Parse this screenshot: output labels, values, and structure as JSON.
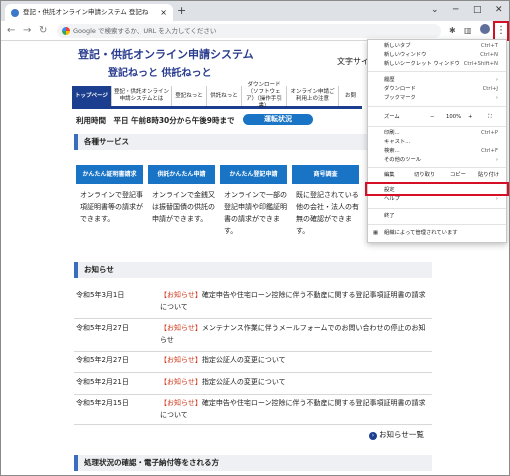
{
  "browser": {
    "tab_title": "登記・供託オンライン申請システム 登記ね",
    "tab_close": "×",
    "new_tab": "+",
    "window_controls": {
      "chevron": "⌄",
      "minimize": "─",
      "maximize": "□",
      "close": "✕"
    },
    "address_placeholder": "Google で検索するか、URL を入力してください",
    "kebab": "⋮"
  },
  "site": {
    "title": "登記・供託オンライン申請システム",
    "subtitle": "登記ねっと 供託ねっと",
    "font_size_label": "文字サイ"
  },
  "nav": [
    {
      "label": "トップページ",
      "active": true
    },
    {
      "label": "登記・供託オンライン申請システムとは"
    },
    {
      "label": "登記ねっと"
    },
    {
      "label": "供託ねっと"
    },
    {
      "label": "ダウンロード（ソフトウェア）（操作手引書）"
    },
    {
      "label": "オンライン申請ご利用上の注意"
    },
    {
      "label": "お問"
    }
  ],
  "hours": {
    "text": "利用時間　平日 午前8時30分から午後9時まで",
    "status_button": "運転状況"
  },
  "services": {
    "heading": "各種サービス",
    "items": [
      {
        "label": "かんたん証明書請求",
        "desc": "オンラインで登記事項証明書等の請求ができます。"
      },
      {
        "label": "供託かんたん申請",
        "desc": "オンラインで金銭又は振替国債の供託の申請ができます。"
      },
      {
        "label": "かんたん登記申請",
        "desc": "オンラインで一部の登記申請や印鑑証明書の請求ができます。"
      },
      {
        "label": "商号調査",
        "desc": "既に登記されている他の会社・法人の有無の確認ができます。"
      }
    ]
  },
  "news": {
    "heading": "お知らせ",
    "items": [
      {
        "date": "令和5年3月1日",
        "badge": "【お知らせ】",
        "text": "確定申告や住宅ローン控除に伴う不動産に関する登記事項証明書の請求について"
      },
      {
        "date": "令和5年2月27日",
        "badge": "【お知らせ】",
        "text": "メンテナンス作業に伴うメールフォームでのお問い合わせの停止のお知らせ"
      },
      {
        "date": "令和5年2月27日",
        "badge": "【お知らせ】",
        "text": "指定公証人の変更について"
      },
      {
        "date": "令和5年2月21日",
        "badge": "【お知らせ】",
        "text": "指定公証人の変更について"
      },
      {
        "date": "令和5年2月15日",
        "badge": "【お知らせ】",
        "text": "確定申告や住宅ローン控除に伴う不動産に関する登記事項証明書の請求について"
      }
    ],
    "more": "お知らせ一覧",
    "more_icon": "›"
  },
  "procedure_heading": "処理状況の確認・電子納付等をされる方",
  "menu": {
    "items_top": [
      {
        "label": "新しいタブ",
        "shortcut": "Ctrl+T"
      },
      {
        "label": "新しいウィンドウ",
        "shortcut": "Ctrl+N"
      },
      {
        "label": "新しいシークレット ウィンドウ",
        "shortcut": "Ctrl+Shift+N"
      }
    ],
    "items_mid": [
      {
        "label": "履歴",
        "shortcut": "›"
      },
      {
        "label": "ダウンロード",
        "shortcut": "Ctrl+J"
      },
      {
        "label": "ブックマーク",
        "shortcut": "›"
      }
    ],
    "zoom": {
      "label": "ズーム",
      "minus": "−",
      "value": "100%",
      "plus": "+",
      "full": "⛶"
    },
    "items_print": [
      {
        "label": "印刷...",
        "shortcut": "Ctrl+P"
      },
      {
        "label": "キャスト..."
      },
      {
        "label": "検索...",
        "shortcut": "Ctrl+F"
      },
      {
        "label": "その他のツール",
        "shortcut": "›"
      }
    ],
    "edit": {
      "label": "編集",
      "cut": "切り取り",
      "copy": "コピー",
      "paste": "貼り付け"
    },
    "settings": "設定",
    "help": "ヘルプ",
    "help_arrow": "›",
    "exit": "終了",
    "managed": "組織によって管理されています"
  },
  "colors": {
    "accent": "#1c3e8f",
    "button_blue": "#1a74c6",
    "highlight_red": "#d50f25",
    "news_badge": "#d0381c"
  }
}
